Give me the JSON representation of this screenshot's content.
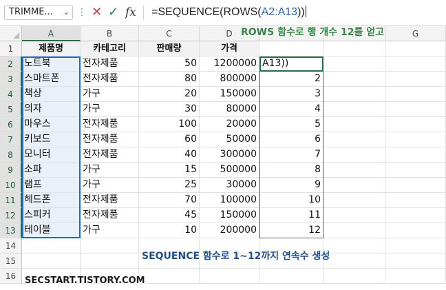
{
  "name_box": "TRIMME...",
  "formula_bar": {
    "prefix": "=SEQUENCE(ROWS(",
    "range_ref": "A2:A13",
    "suffix": "))",
    "icons": [
      "more-icon",
      "cancel-icon",
      "enter-icon",
      "fx-icon"
    ]
  },
  "columns": [
    "A",
    "B",
    "C",
    "D",
    "E",
    "F",
    "G"
  ],
  "rows": [
    "1",
    "2",
    "3",
    "4",
    "5",
    "6",
    "7",
    "8",
    "9",
    "10",
    "11",
    "12",
    "13",
    "14",
    "15",
    "16"
  ],
  "headers": [
    "제품명",
    "카테고리",
    "판매량",
    "가격"
  ],
  "data": [
    [
      "노트북",
      "전자제품",
      "50",
      "1200000"
    ],
    [
      "스마트폰",
      "전자제품",
      "80",
      "800000"
    ],
    [
      "책상",
      "가구",
      "20",
      "150000"
    ],
    [
      "의자",
      "가구",
      "30",
      "80000"
    ],
    [
      "마우스",
      "전자제품",
      "100",
      "20000"
    ],
    [
      "키보드",
      "전자제품",
      "60",
      "50000"
    ],
    [
      "모니터",
      "전자제품",
      "40",
      "300000"
    ],
    [
      "소파",
      "가구",
      "15",
      "500000"
    ],
    [
      "램프",
      "가구",
      "25",
      "30000"
    ],
    [
      "헤드폰",
      "전자제품",
      "70",
      "100000"
    ],
    [
      "스피커",
      "전자제품",
      "45",
      "150000"
    ],
    [
      "테이블",
      "가구",
      "10",
      "200000"
    ]
  ],
  "sequence_column": {
    "edit_text": "A13))",
    "values": [
      "2",
      "3",
      "4",
      "5",
      "6",
      "7",
      "8",
      "9",
      "10",
      "11",
      "12"
    ]
  },
  "annotations": {
    "top": "ROWS 함수로 행 개수 12를 얻고",
    "bottom": "SEQUENCE 함수로 1~12까지 연속수 생성"
  },
  "watermark": "SECSTART.TISTORY.COM",
  "colors": {
    "range_highlight": "#2167c5",
    "selection": "#1f7244",
    "annotation_green": "#2e8b3e",
    "annotation_blue": "#1e4e8c"
  }
}
